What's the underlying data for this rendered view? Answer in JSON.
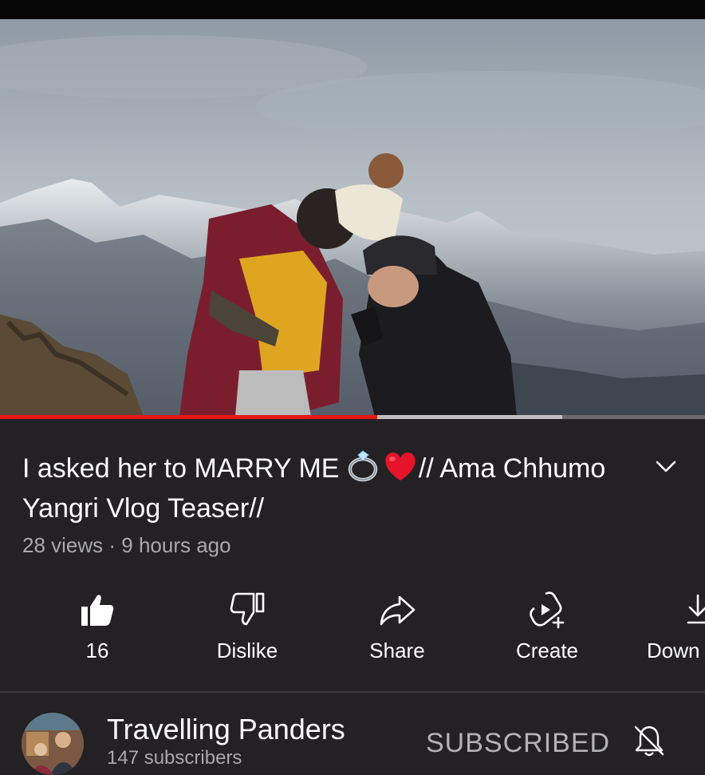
{
  "video": {
    "title_part1": "I asked her to MARRY ME ",
    "title_part2": "// Ama Chhumo Yangri Vlog Teaser//",
    "views": "28 views",
    "separator": " · ",
    "age": "9 hours ago",
    "progress_fraction": 0.535,
    "buffer_fraction": 0.797
  },
  "actions": {
    "like_count": "16",
    "dislike_label": "Dislike",
    "share_label": "Share",
    "create_label": "Create",
    "download_label": "Down"
  },
  "channel": {
    "name": "Travelling Panders",
    "subscribers": "147 subscribers",
    "subscribed_label": "SUBSCRIBED"
  },
  "colors": {
    "background": "#232124",
    "progress": "#e51717",
    "muted_text": "#a9a9a9"
  },
  "icons": [
    "ring-emoji",
    "heart-emoji",
    "chevron-down-icon",
    "like-icon",
    "dislike-icon",
    "share-icon",
    "create-icon",
    "download-icon",
    "bell-off-icon"
  ]
}
